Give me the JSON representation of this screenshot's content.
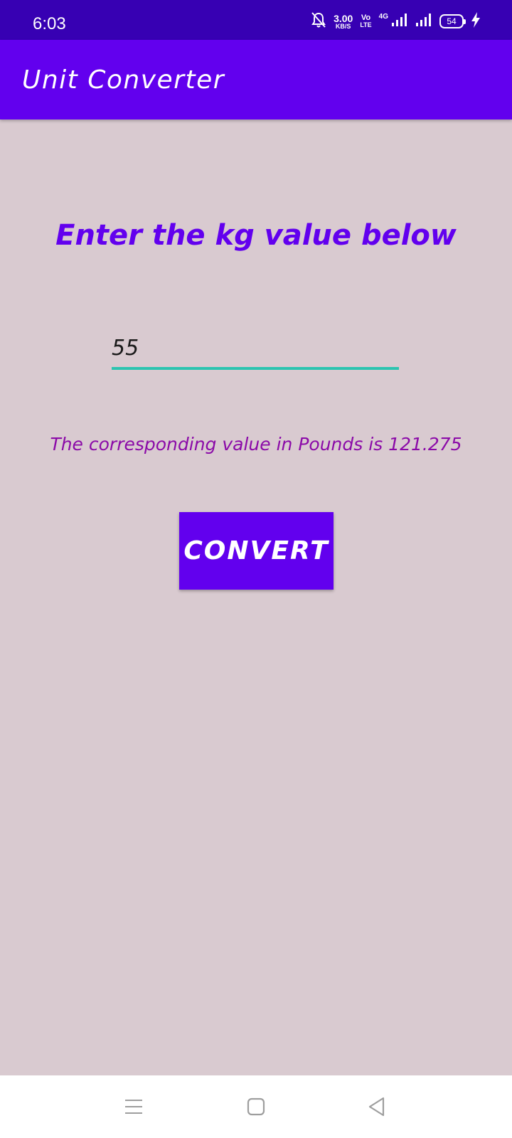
{
  "status_bar": {
    "time": "6:03",
    "net_speed_value": "3.00",
    "net_speed_unit": "KB/S",
    "volte_top": "Vo",
    "volte_bottom": "LTE",
    "network_type": "4G",
    "battery_level": "54",
    "icons": [
      "bell-off-icon",
      "signal-icon",
      "signal-icon-2",
      "battery-icon",
      "charging-icon"
    ]
  },
  "app_bar": {
    "title": "Unit Converter",
    "color": "#6200ee"
  },
  "main": {
    "heading": "Enter the kg value below",
    "input_value": "55",
    "result_text": "The corresponding value in Pounds is 121.275",
    "convert_label": "CONVERT"
  },
  "nav_bar": {
    "icons": [
      "menu-icon",
      "home-square-icon",
      "back-triangle-icon"
    ]
  },
  "colors": {
    "status_bar": "#3700b3",
    "primary": "#6200ee",
    "background": "#d9cad0",
    "input_underline": "#2bc4b0",
    "result_text": "#8b0aa8"
  }
}
